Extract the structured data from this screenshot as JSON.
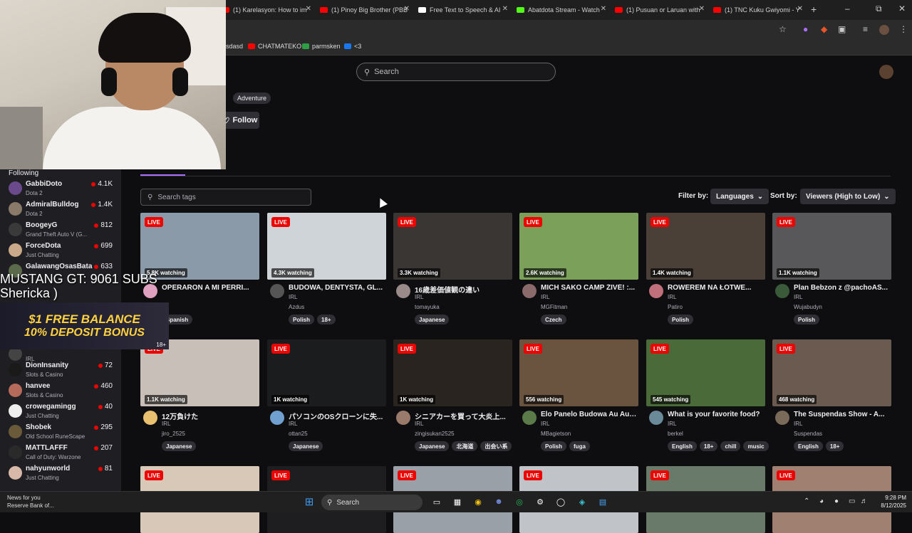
{
  "browser": {
    "tabs": [
      {
        "label": "(1) Karelasyon: How to im",
        "color": "#ff0000"
      },
      {
        "label": "(1) Pinoy Big Brother (PBB",
        "color": "#ff0000"
      },
      {
        "label": "Free Text to Speech & AI",
        "color": "#ffffff"
      },
      {
        "label": "Abatdota Stream - Watch",
        "color": "#53fc18"
      },
      {
        "label": "(1) Pusuan or Laruan with",
        "color": "#ff0000"
      },
      {
        "label": "(1) TNC Kuku Gwiyomi - Y",
        "color": "#ff0000"
      }
    ],
    "bookmarks": [
      {
        "label": "sdasd",
        "color": "#888888"
      },
      {
        "label": "CHATMATEKO",
        "color": "#ff0000"
      },
      {
        "label": "parmsken",
        "color": "#2e9e44"
      },
      {
        "label": "<3",
        "color": "#1877f2"
      }
    ]
  },
  "header": {
    "search_placeholder": "Search"
  },
  "channel": {
    "tag": "Adventure",
    "follow_label": "Follow"
  },
  "overlay": {
    "goal_text": "MUSTANG GT: 9061 SUBS",
    "name_text": "Shericka )",
    "ad_line1": "$1 FREE BALANCE",
    "ad_line2": "10% DEPOSIT BONUS",
    "ad_badge": "18+"
  },
  "sidebar": {
    "title": "Following",
    "items": [
      {
        "name": "GabbiDoto",
        "game": "Dota 2",
        "viewers": "4.1K",
        "color": "#6a4a8a"
      },
      {
        "name": "AdmiralBulldog",
        "game": "Dota 2",
        "viewers": "1.4K",
        "color": "#8a7a6a"
      },
      {
        "name": "BoogeyG",
        "game": "Grand Theft Auto V (G...",
        "viewers": "812",
        "color": "#3a3a3a"
      },
      {
        "name": "ForceDota",
        "game": "Just Chatting",
        "viewers": "699",
        "color": "#c9a98a"
      },
      {
        "name": "GalawangOsasBata",
        "game": "",
        "viewers": "633",
        "color": "#5a6a4a"
      },
      {
        "name": "",
        "game": "IRL",
        "viewers": "",
        "color": "#444444"
      },
      {
        "name": "DionInsanity",
        "game": "Slots & Casino",
        "viewers": "72",
        "color": "#1a1a1a"
      },
      {
        "name": "hanvee",
        "game": "Slots & Casino",
        "viewers": "460",
        "color": "#b56a5a"
      },
      {
        "name": "crowegamingg",
        "game": "Just Chatting",
        "viewers": "40",
        "color": "#eeeeee"
      },
      {
        "name": "Shobek",
        "game": "Old School RuneScape",
        "viewers": "295",
        "color": "#6a5a3a"
      },
      {
        "name": "MATTLAFFF",
        "game": "Call of Duty: Warzone",
        "viewers": "207",
        "color": "#2a2a2a"
      },
      {
        "name": "nahyunworld",
        "game": "Just Chatting",
        "viewers": "81",
        "color": "#d8b8a8"
      }
    ]
  },
  "filters": {
    "tag_search_placeholder": "Search tags",
    "filter_label": "Filter by:",
    "filter_value": "Languages",
    "sort_label": "Sort by:",
    "sort_value": "Viewers (High to Low)"
  },
  "streams": [
    {
      "viewers": "5.8K watching",
      "title": "OPERARON A MI PERRI...",
      "category": "",
      "user": "nz",
      "tags": [
        "Spanish"
      ],
      "bg": "#8a9aa8",
      "av": "#e0a0c0"
    },
    {
      "viewers": "4.3K watching",
      "title": "BUDOWA, DENTYSTA, GL...",
      "category": "IRL",
      "user": "Azdus",
      "tags": [
        "Polish",
        "18+"
      ],
      "bg": "#cfd4d8",
      "av": "#555555"
    },
    {
      "viewers": "3.3K watching",
      "title": "16歳差価値観の違い",
      "category": "IRL",
      "user": "tomayuka",
      "tags": [
        "Japanese"
      ],
      "bg": "#3a3634",
      "av": "#9a8a8a"
    },
    {
      "viewers": "2.6K watching",
      "title": "MICH SAKO CAMP ŽIVĚ! :...",
      "category": "IRL",
      "user": "MGFitman",
      "tags": [
        "Czech"
      ],
      "bg": "#7aa05a",
      "av": "#8a6a6a"
    },
    {
      "viewers": "1.4K watching",
      "title": "ROWEREM NA ŁOTWE...",
      "category": "IRL",
      "user": "Patiro",
      "tags": [
        "Polish"
      ],
      "bg": "#4a4038",
      "av": "#c0707a"
    },
    {
      "viewers": "1.1K watching",
      "title": "Plan Bebzon z @pachoAS...",
      "category": "IRL",
      "user": "Wujabudyn",
      "tags": [
        "Polish"
      ],
      "bg": "#58585a",
      "av": "#3a5a3a"
    },
    {
      "viewers": "1.1K watching",
      "title": "12万負けた",
      "category": "IRL",
      "user": "jiro_2525",
      "tags": [
        "Japanese"
      ],
      "bg": "#c8c0b8",
      "av": "#e8c070"
    },
    {
      "viewers": "1K watching",
      "title": "パソコンのOSクローンに失...",
      "category": "IRL",
      "user": "ottan25",
      "tags": [
        "Japanese"
      ],
      "bg": "#1a1c1e",
      "av": "#70a0d0"
    },
    {
      "viewers": "1K watching",
      "title": "シニアカーを買って大炎上...",
      "category": "IRL",
      "user": "zingisukan2525",
      "tags": [
        "Japanese",
        "北海道",
        "出会い系"
      ],
      "bg": "#2a2420",
      "av": "#9a7a6a"
    },
    {
      "viewers": "556 watching",
      "title": "Elo Panelo Budowa Au Au ...",
      "category": "IRL",
      "user": "MBagietson",
      "tags": [
        "Polish",
        "fuga"
      ],
      "bg": "#6a5440",
      "av": "#5a7a4a"
    },
    {
      "viewers": "545 watching",
      "title": "What is your favorite food?",
      "category": "IRL",
      "user": "berkel",
      "tags": [
        "English",
        "18+",
        "chill",
        "music"
      ],
      "bg": "#4a6a3a",
      "av": "#6a8a9a"
    },
    {
      "viewers": "468 watching",
      "title": "The Suspendas Show - A...",
      "category": "IRL",
      "user": "Suspendas",
      "tags": [
        "English",
        "18+"
      ],
      "bg": "#6a5a50",
      "av": "#7a6a5a"
    },
    {
      "viewers": "",
      "title": "",
      "category": "",
      "user": "",
      "tags": [],
      "bg": "#d8c8b8",
      "av": ""
    },
    {
      "viewers": "",
      "title": "",
      "category": "",
      "user": "",
      "tags": [],
      "bg": "#1e1e20",
      "av": ""
    },
    {
      "viewers": "",
      "title": "",
      "category": "",
      "user": "",
      "tags": [],
      "bg": "#9aa0a8",
      "av": ""
    },
    {
      "viewers": "",
      "title": "",
      "category": "",
      "user": "",
      "tags": [],
      "bg": "#c0c4c8",
      "av": ""
    },
    {
      "viewers": "",
      "title": "",
      "category": "",
      "user": "",
      "tags": [],
      "bg": "#6a7a6a",
      "av": ""
    },
    {
      "viewers": "",
      "title": "",
      "category": "",
      "user": "",
      "tags": [],
      "bg": "#a08070",
      "av": ""
    }
  ],
  "live_label": "LIVE",
  "taskbar": {
    "news_line1": "News for you",
    "news_line2": "Reserve Bank of...",
    "search": "Search",
    "time": "9:28 PM",
    "date": "8/12/2025"
  }
}
